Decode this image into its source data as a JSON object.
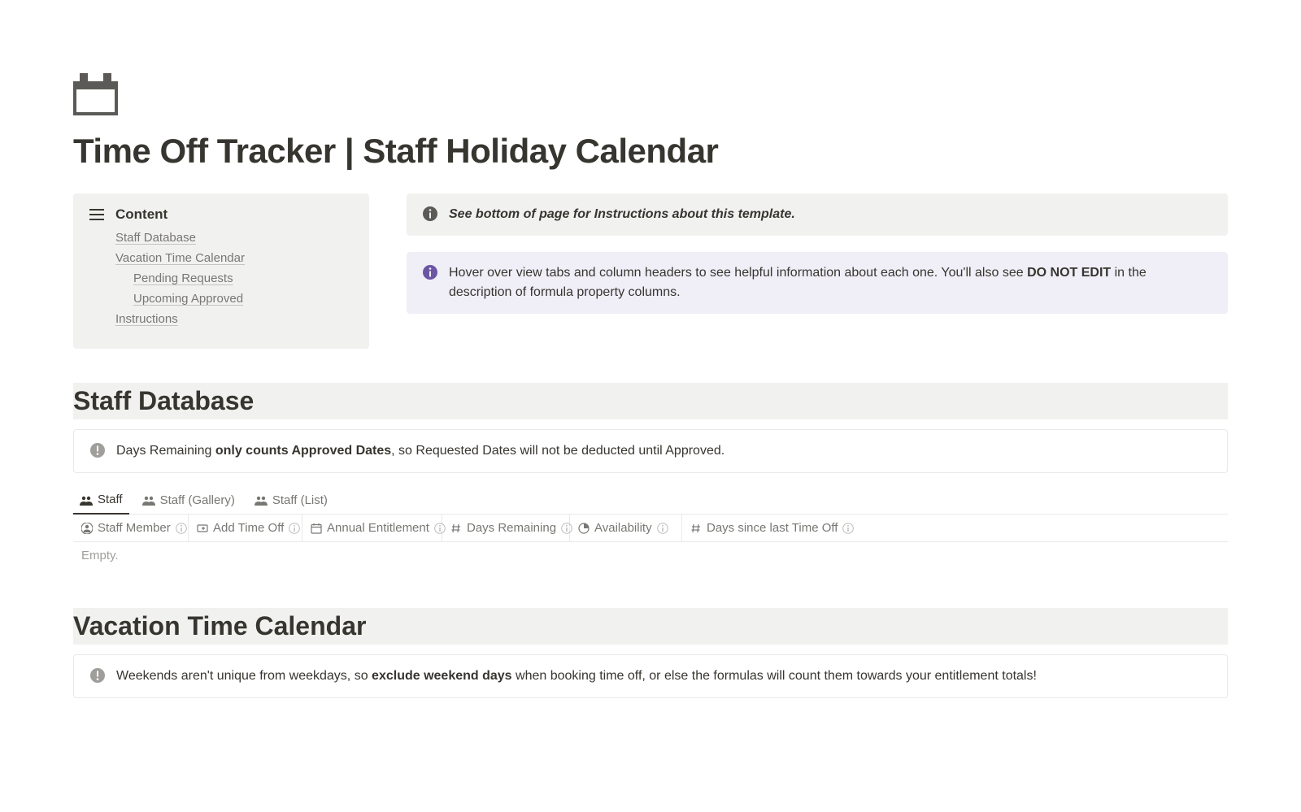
{
  "page": {
    "title": "Time Off Tracker | Staff Holiday Calendar"
  },
  "toc": {
    "title": "Content",
    "items": [
      {
        "label": "Staff Database",
        "level": 0
      },
      {
        "label": "Vacation Time Calendar",
        "level": 0
      },
      {
        "label": "Pending Requests",
        "level": 1
      },
      {
        "label": "Upcoming Approved",
        "level": 1
      },
      {
        "label": "Instructions",
        "level": 0
      }
    ]
  },
  "callouts": {
    "instructions_hint": "See bottom of page for Instructions about this template.",
    "hover_hint_prefix": "Hover over view tabs and column headers to see helpful information about each one. You'll also see ",
    "hover_hint_bold": "DO NOT EDIT",
    "hover_hint_suffix": " in the description of formula property columns."
  },
  "staff_db": {
    "heading": "Staff Database",
    "note_prefix": "Days Remaining ",
    "note_bold": "only counts Approved Dates",
    "note_suffix": ", so Requested Dates will not be deducted until Approved.",
    "tabs": [
      {
        "label": "Staff",
        "active": true
      },
      {
        "label": "Staff (Gallery)",
        "active": false
      },
      {
        "label": "Staff (List)",
        "active": false
      }
    ],
    "columns": [
      {
        "label": "Staff Member",
        "icon": "person"
      },
      {
        "label": "Add Time Off",
        "icon": "button"
      },
      {
        "label": "Annual Entitlement",
        "icon": "calendar"
      },
      {
        "label": "Days Remaining",
        "icon": "number"
      },
      {
        "label": "Availability",
        "icon": "progress"
      },
      {
        "label": "Days since last Time Off",
        "icon": "number"
      }
    ],
    "empty_label": "Empty."
  },
  "vacation": {
    "heading": "Vacation Time Calendar",
    "note_prefix": "Weekends aren't unique from weekdays, so ",
    "note_bold": "exclude weekend days",
    "note_suffix": " when booking time off, or else the formulas will count them towards your entitlement totals!"
  }
}
